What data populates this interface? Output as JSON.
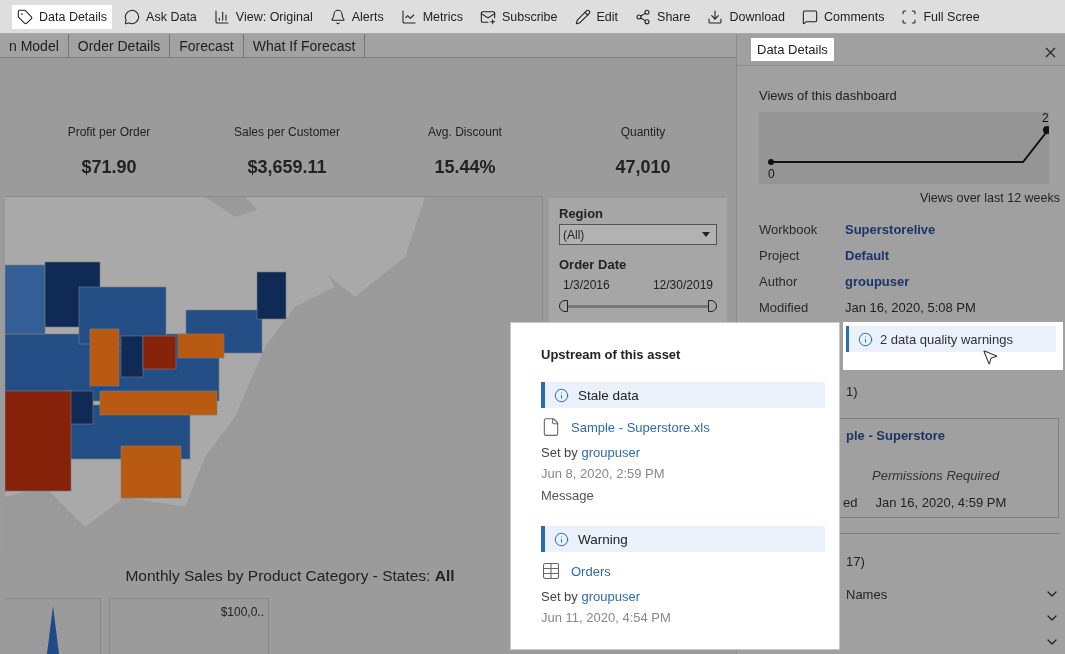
{
  "toolbar": {
    "items": [
      {
        "label": "Data Details",
        "selected": true
      },
      {
        "label": "Ask Data",
        "selected": false
      },
      {
        "label": "View: Original",
        "selected": false
      },
      {
        "label": "Alerts",
        "selected": false
      },
      {
        "label": "Metrics",
        "selected": false
      },
      {
        "label": "Subscribe",
        "selected": false
      },
      {
        "label": "Edit",
        "selected": false
      },
      {
        "label": "Share",
        "selected": false
      },
      {
        "label": "Download",
        "selected": false
      },
      {
        "label": "Comments",
        "selected": false
      },
      {
        "label": "Full Scree",
        "selected": false
      }
    ]
  },
  "tabs": [
    {
      "label": "n Model",
      "selected": false
    },
    {
      "label": "Order Details",
      "selected": false
    },
    {
      "label": "Forecast",
      "selected": false
    },
    {
      "label": "What If Forecast",
      "selected": false
    }
  ],
  "kpis": [
    {
      "label": "Profit per Order",
      "value": "$71.90"
    },
    {
      "label": "Sales per Customer",
      "value": "$3,659.11"
    },
    {
      "label": "Avg. Discount",
      "value": "15.44%"
    },
    {
      "label": "Quantity",
      "value": "47,010"
    }
  ],
  "filters": {
    "region": {
      "label": "Region",
      "value": "(All)"
    },
    "order_date": {
      "label": "Order Date",
      "start": "1/3/2016",
      "end": "12/30/2019",
      "level": 1
    }
  },
  "sales_chart": {
    "title": "Monthly Sales by Product Category - States: **All**",
    "axis_label": "$100,0.."
  },
  "data_details": {
    "title": "Data Details",
    "views_title": "Views of this dashboard",
    "views_max": "2",
    "views_min": "0",
    "views_caption": "Views over last 12 weeks",
    "details": [
      {
        "label": "Workbook",
        "value": "Superstorelive",
        "kind": "link"
      },
      {
        "label": "Project",
        "value": "Default",
        "kind": "link"
      },
      {
        "label": "Author",
        "value": "groupuser",
        "kind": "link"
      },
      {
        "label": "Modified",
        "value": "Jan 16, 2020, 5:08 PM",
        "kind": "text"
      }
    ],
    "warnings_badge": "2 data quality warnings",
    "connections": {
      "count": "1)",
      "name": "ple - Superstore",
      "note": "Permissions Required",
      "date_label": "ed",
      "date": "Jan 16, 2020, 4:59 PM"
    },
    "fields": {
      "count": "17)",
      "items": [
        {
          "label": "Names",
          "expanded": false
        },
        {
          "expanded": false
        },
        {
          "expanded": false
        }
      ]
    }
  },
  "popover": {
    "title": "Upstream of this asset",
    "warnings": [
      {
        "title": "Stale data",
        "kind": "file",
        "asset": "Sample - Superstore.xls",
        "set_by": "Set by",
        "user": "groupuser",
        "date": "Jun 8, 2020, 2:59 PM",
        "message": "Message"
      },
      {
        "title": "Warning",
        "kind": "table",
        "asset": "Orders",
        "set_by": "Set by",
        "user": "groupuser",
        "date": "Jun 11, 2020, 4:54 PM"
      }
    ]
  }
}
